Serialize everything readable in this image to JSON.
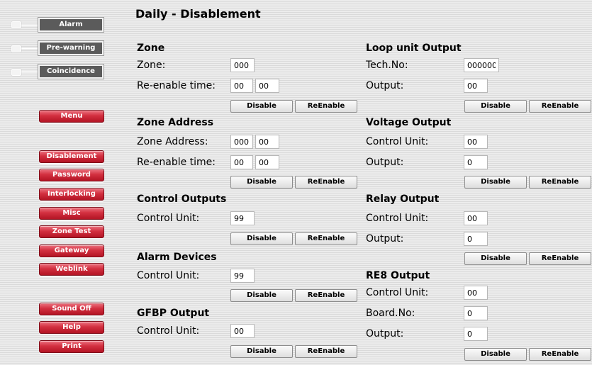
{
  "status": {
    "alarm": "Alarm",
    "prewarning": "Pre-warning",
    "coincidence": "Coincidence"
  },
  "menu": {
    "menu": "Menu",
    "items": [
      "Disablement",
      "Password",
      "Interlocking",
      "Misc",
      "Zone Test",
      "Gateway",
      "Weblink"
    ],
    "sound_off": "Sound Off",
    "help": "Help",
    "print": "Print"
  },
  "page_title": "Daily - Disablement",
  "buttons": {
    "disable": "Disable",
    "reenable": "ReEnable"
  },
  "zone": {
    "title": "Zone",
    "zone_label": "Zone:",
    "zone_value": "000",
    "time_label": "Re-enable time:",
    "time_h": "00",
    "time_m": "00"
  },
  "zone_address": {
    "title": "Zone Address",
    "addr_label": "Zone Address:",
    "addr_a": "000",
    "addr_b": "00",
    "time_label": "Re-enable time:",
    "time_h": "00",
    "time_m": "00"
  },
  "control_outputs": {
    "title": "Control Outputs",
    "cu_label": "Control Unit:",
    "cu_value": "99"
  },
  "alarm_devices": {
    "title": "Alarm Devices",
    "cu_label": "Control Unit:",
    "cu_value": "99"
  },
  "gfbp_output": {
    "title": "GFBP Output",
    "cu_label": "Control Unit:",
    "cu_value": "00"
  },
  "loop_unit_output": {
    "title": "Loop unit Output",
    "tech_label": "Tech.No:",
    "tech_value": "000000",
    "out_label": "Output:",
    "out_value": "00"
  },
  "voltage_output": {
    "title": "Voltage Output",
    "cu_label": "Control Unit:",
    "cu_value": "00",
    "out_label": "Output:",
    "out_value": "0"
  },
  "relay_output": {
    "title": "Relay Output",
    "cu_label": "Control Unit:",
    "cu_value": "00",
    "out_label": "Output:",
    "out_value": "0"
  },
  "re8_output": {
    "title": "RE8 Output",
    "cu_label": "Control Unit:",
    "cu_value": "00",
    "board_label": "Board.No:",
    "board_value": "0",
    "out_label": "Output:",
    "out_value": "0"
  }
}
